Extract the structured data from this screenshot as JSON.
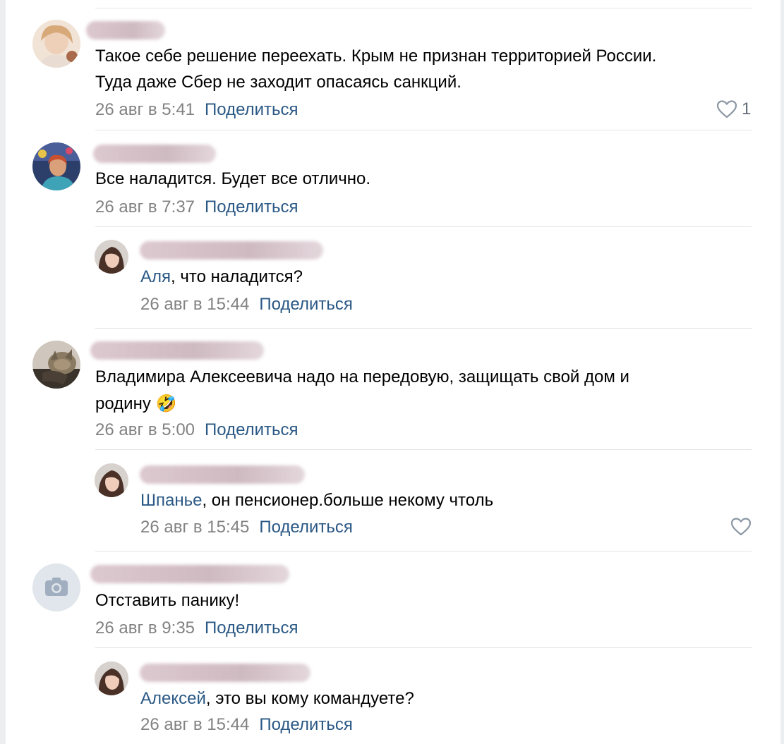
{
  "share_label": "Поделиться",
  "comments": [
    {
      "text": "Такое себе решение переехать. Крым не признан территорией России.",
      "text2": "Туда даже Сбер не заходит опасаясь санкций.",
      "date": "26 авг в 5:41",
      "likes": "1"
    },
    {
      "text": "Все наладится. Будет все отлично.",
      "date": "26 авг в 7:37",
      "reply": {
        "mention": "Аля",
        "text": ", что наладится?",
        "date": "26 авг в 15:44"
      }
    },
    {
      "text": "Владимира Алексеевича надо на передовую, защищать свой дом и",
      "text2": "родину",
      "emoji": "🤣",
      "date": "26 авг в 5:00",
      "reply": {
        "mention": "Шпанье",
        "text": ", он пенсионер.больше некому чтоль",
        "date": "26 авг в 15:45"
      }
    },
    {
      "text": "Отставить панику!",
      "date": "26 авг в 9:35",
      "reply": {
        "mention": "Алексей",
        "text": ", это вы кому командуете?",
        "date": "26 авг в 15:44"
      }
    }
  ],
  "colors": {
    "link": "#2a5885",
    "meta": "#828282",
    "divider": "#e3e4e8"
  },
  "icons": [
    "heart-icon",
    "camera-icon"
  ]
}
